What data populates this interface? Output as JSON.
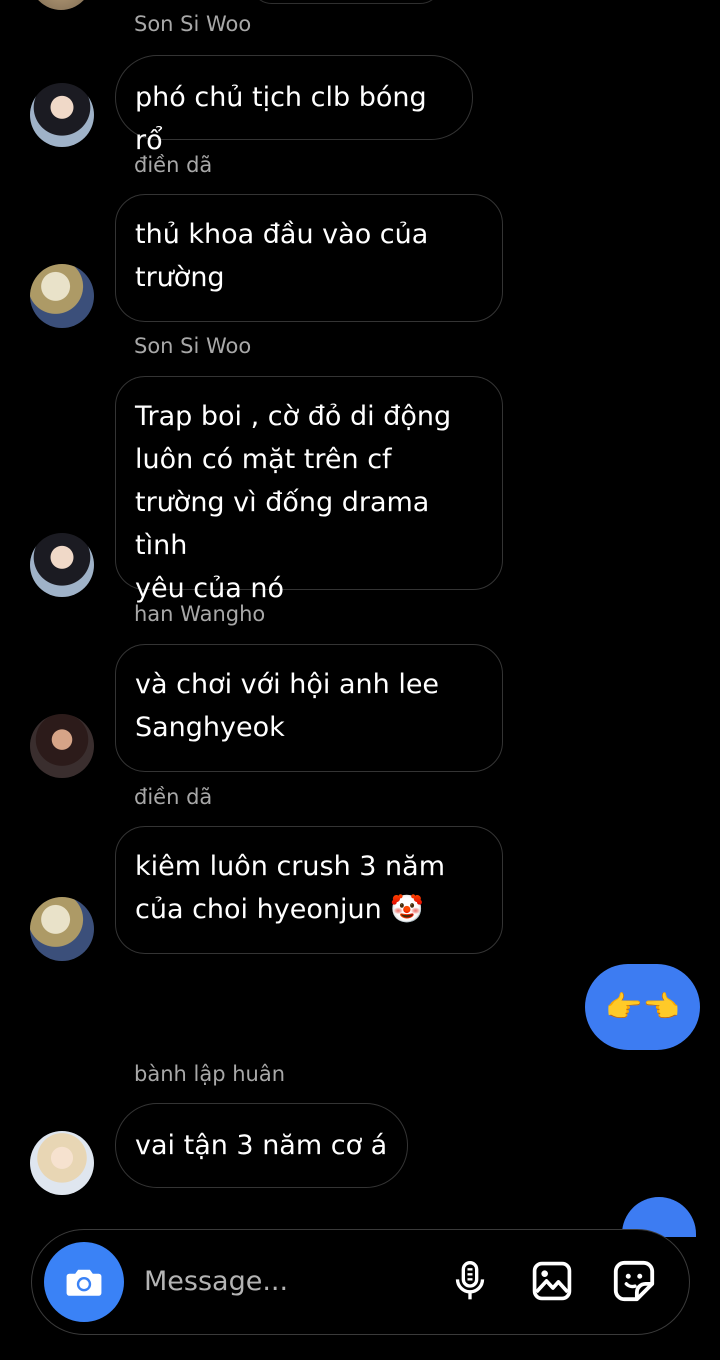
{
  "messages": [
    {
      "sender": "Son Si Woo",
      "text": "phó chủ tịch clb bóng rổ"
    },
    {
      "sender": "điền dã",
      "text": "thủ khoa đầu vào của\ntrường"
    },
    {
      "sender": "Son Si Woo",
      "text": "Trap boi , cờ đỏ di động\nluôn có mặt trên cf\ntrường vì đống drama tình\nyêu của nó"
    },
    {
      "sender": "han Wangho",
      "text": "và chơi với hội anh lee\nSanghyeok"
    },
    {
      "sender": "điền dã",
      "text": "kiêm luôn crush 3 năm\ncủa choi hyeonjun 🤡"
    },
    {
      "sender": "bành lập huân",
      "text": "vai tận 3 năm cơ á"
    }
  ],
  "my_message": {
    "text": "👉👈"
  },
  "composer": {
    "placeholder": "Message...",
    "icons": [
      "camera-icon",
      "microphone-icon",
      "gallery-icon",
      "sticker-icon"
    ]
  },
  "colors": {
    "background": "#000000",
    "bubble_border": "#343434",
    "my_bubble": "#3d7cf2",
    "camera_button": "#3a82f6",
    "sender_name": "#a8a8a8"
  }
}
